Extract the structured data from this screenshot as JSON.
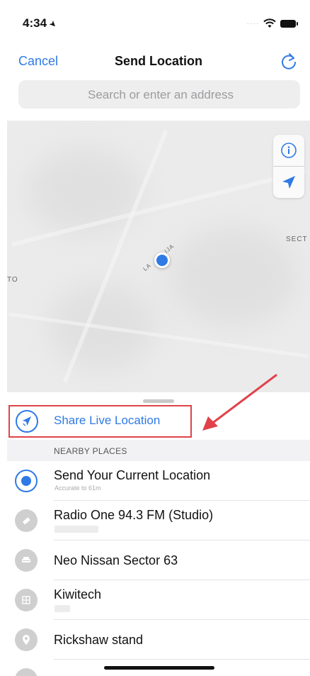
{
  "status_bar": {
    "time": "4:34"
  },
  "nav": {
    "cancel_label": "Cancel",
    "title": "Send Location"
  },
  "search": {
    "placeholder": "Search or enter an address"
  },
  "map": {
    "labels": [
      "SECT",
      "TO",
      "LA",
      "IJA"
    ]
  },
  "share_live": {
    "label": "Share Live Location"
  },
  "section": {
    "nearby_header": "NEARBY PLACES"
  },
  "places": [
    {
      "title": "Send Your Current Location",
      "subtitle": "Accurate to 61m",
      "icon": "current-location-icon"
    },
    {
      "title": "Radio One 94.3 FM (Studio)",
      "icon": "radio-icon"
    },
    {
      "title": "Neo Nissan Sector 63",
      "icon": "car-icon"
    },
    {
      "title": "Kiwitech",
      "icon": "building-icon"
    },
    {
      "title": "Rickshaw stand",
      "icon": "pin-icon"
    }
  ],
  "colors": {
    "accent": "#2f7ae5",
    "highlight": "#e0424a"
  }
}
